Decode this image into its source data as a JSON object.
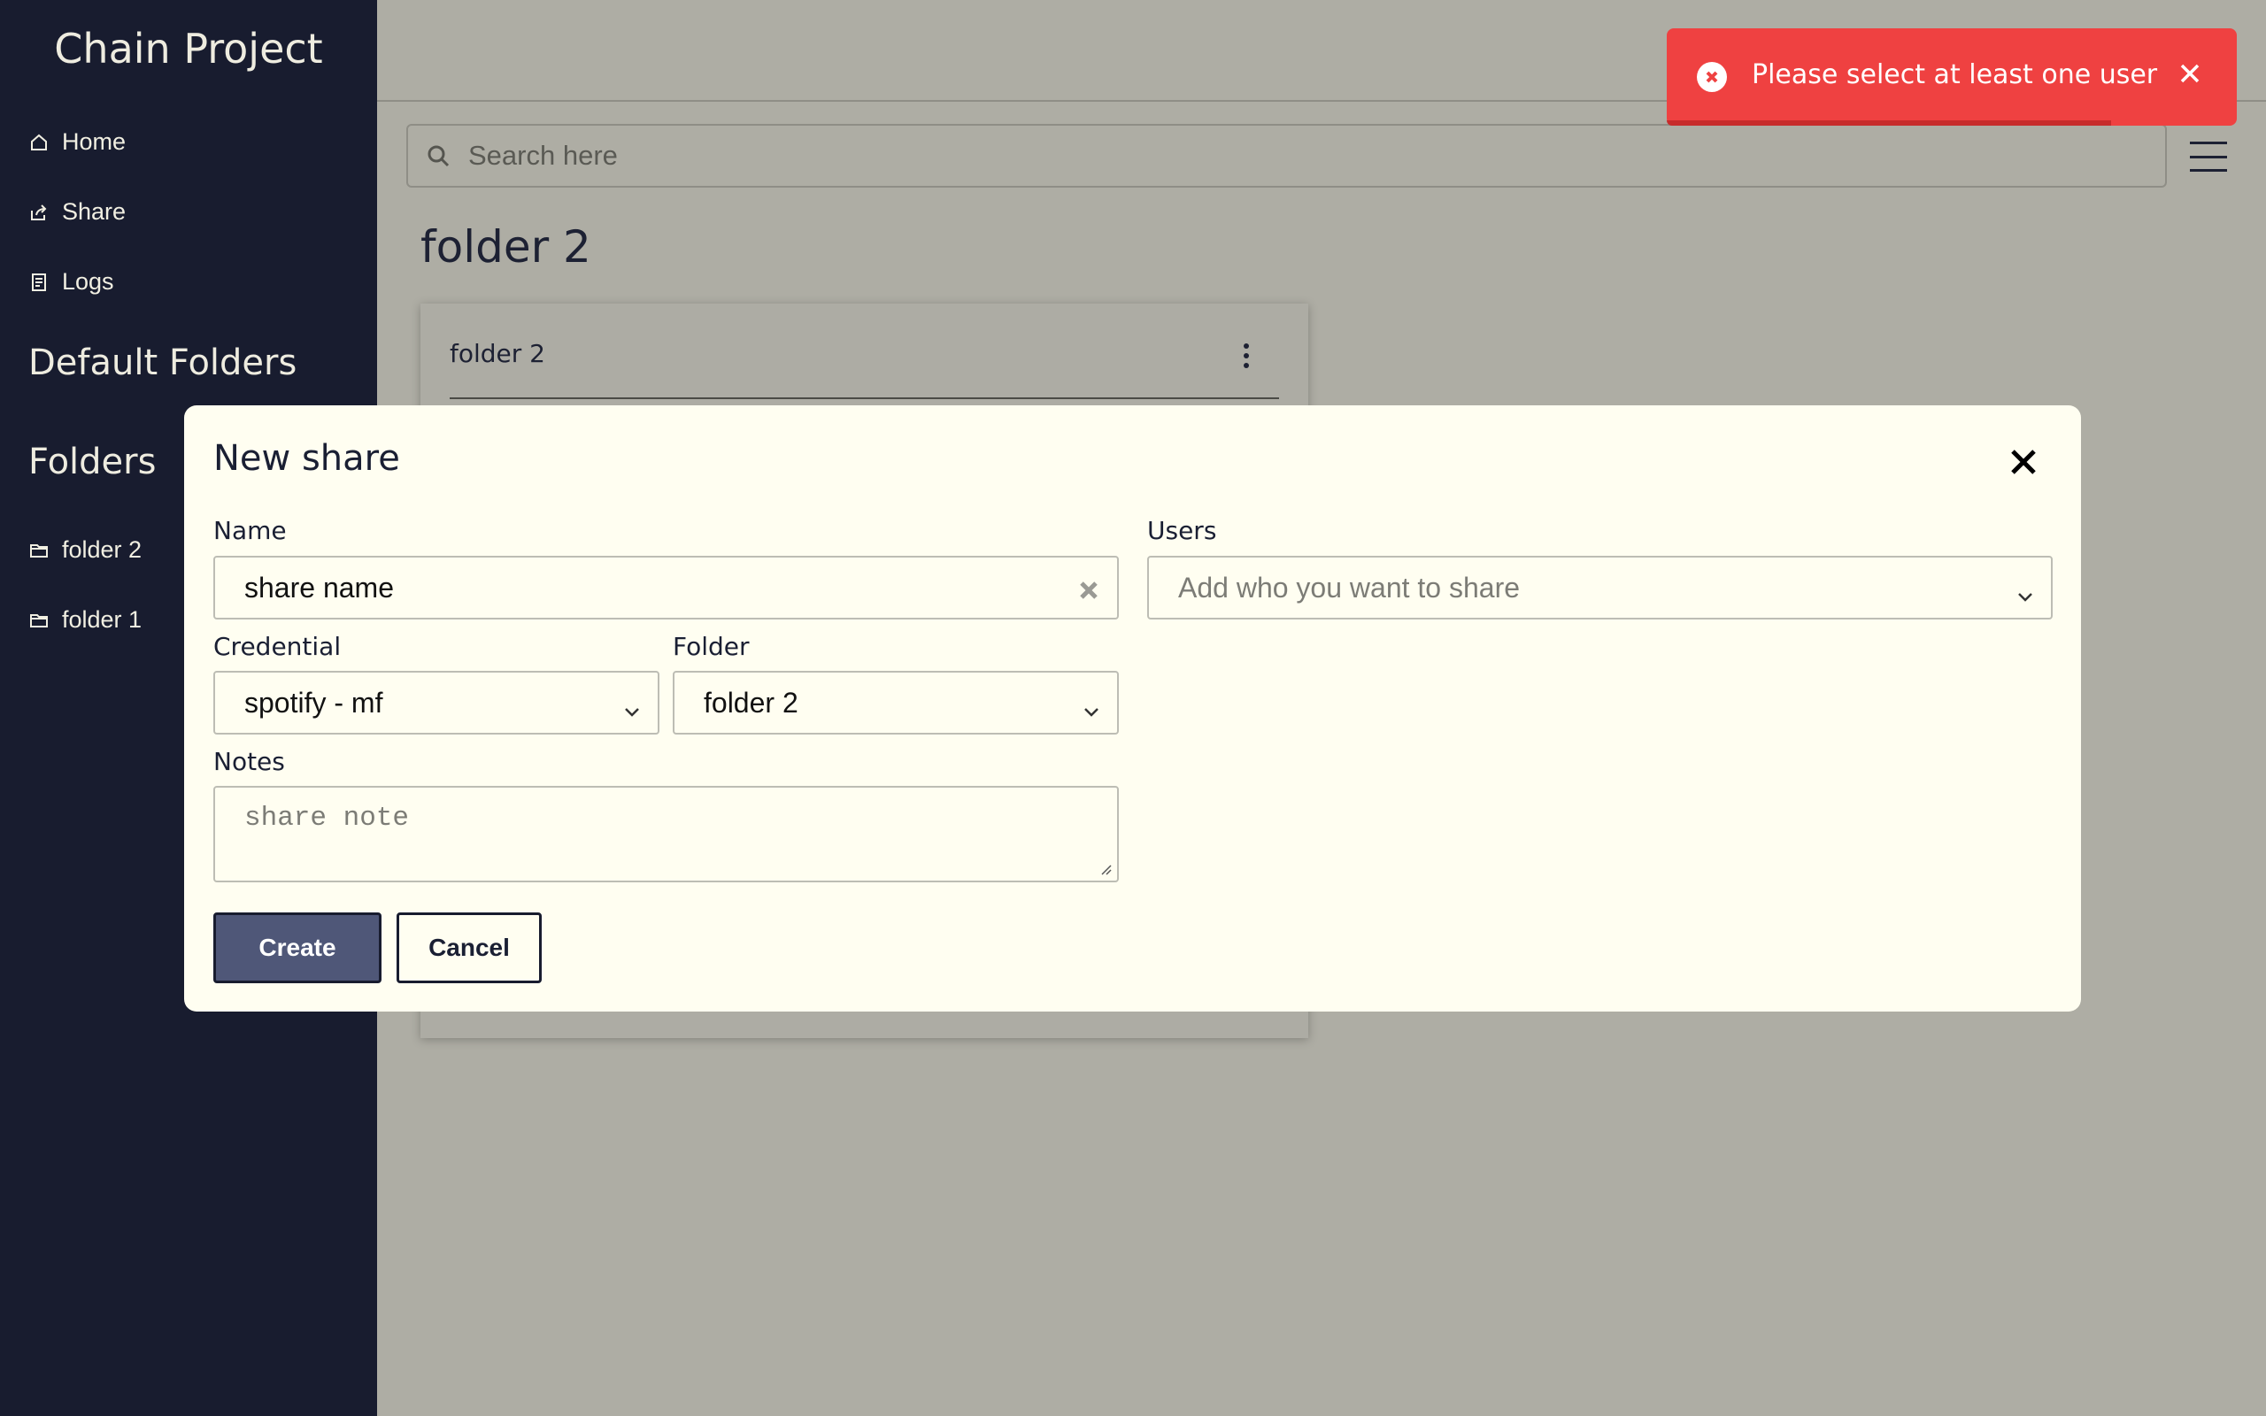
{
  "app": {
    "title": "Chain Project"
  },
  "sidebar": {
    "nav": [
      {
        "label": "Home",
        "icon": "home-icon"
      },
      {
        "label": "Share",
        "icon": "share-icon"
      },
      {
        "label": "Logs",
        "icon": "logs-icon"
      }
    ],
    "default_folders_title": "Default Folders",
    "folders_title": "Folders",
    "folders": [
      {
        "label": "folder 2",
        "icon": "folder-icon"
      },
      {
        "label": "folder 1",
        "icon": "folder-icon"
      }
    ]
  },
  "header": {
    "search_placeholder": "Search here"
  },
  "main": {
    "page_title": "folder 2",
    "card": {
      "title": "folder 2"
    }
  },
  "modal": {
    "title": "New share",
    "name": {
      "label": "Name",
      "value": "share name"
    },
    "users": {
      "label": "Users",
      "placeholder": "Add who you want to share"
    },
    "credential": {
      "label": "Credential",
      "value": "spotify - mf"
    },
    "folder": {
      "label": "Folder",
      "value": "folder 2"
    },
    "notes": {
      "label": "Notes",
      "placeholder": "share note"
    },
    "create_label": "Create",
    "cancel_label": "Cancel"
  },
  "toast": {
    "message": "Please select at least one user",
    "progress": 0.78,
    "color": "#ef4141"
  },
  "colors": {
    "sidebar": "#181c2f",
    "modal_bg": "#fffef1",
    "primary_button": "#4f5778",
    "overlay": "#aeada4"
  }
}
